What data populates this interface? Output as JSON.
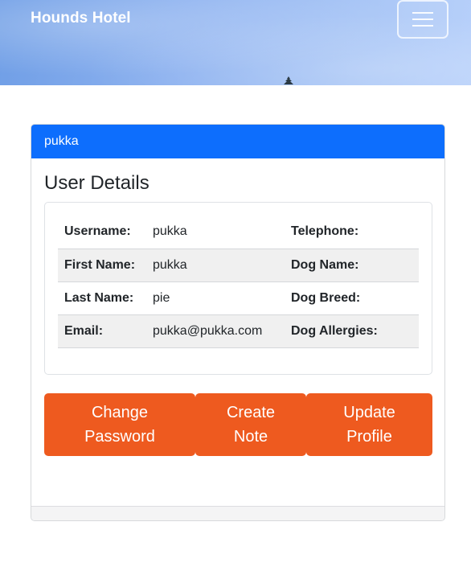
{
  "navbar": {
    "brand": "Hounds Hotel",
    "menu_icon": "hamburger-menu-icon"
  },
  "card": {
    "header": "pukka",
    "section_title": "User Details"
  },
  "details": {
    "rows": [
      {
        "left_label": "Username:",
        "left_value": "pukka",
        "right_label": "Telephone:",
        "right_value": ""
      },
      {
        "left_label": "First Name:",
        "left_value": "pukka",
        "right_label": "Dog Name:",
        "right_value": ""
      },
      {
        "left_label": "Last Name:",
        "left_value": "pie",
        "right_label": "Dog Breed:",
        "right_value": ""
      },
      {
        "left_label": "Email:",
        "left_value": "pukka@pukka.com",
        "right_label": "Dog Allergies:",
        "right_value": ""
      }
    ]
  },
  "actions": {
    "change_password": [
      "Change",
      "Password"
    ],
    "create_note": [
      "Create",
      "Note"
    ],
    "update_profile": [
      "Update",
      "Profile"
    ]
  },
  "colors": {
    "primary": "#0d6efd",
    "accent": "#ee5a1f"
  }
}
